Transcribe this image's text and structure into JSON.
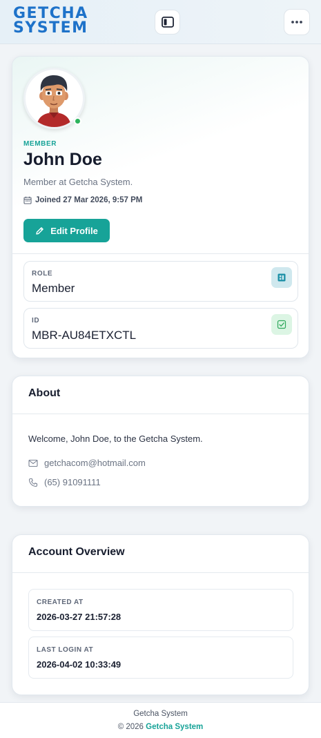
{
  "header": {
    "logo_line1": "GETCHA",
    "logo_line2": "SYSTEM",
    "sidebar_toggle_icon": "panel-left-icon",
    "more_icon": "more-horizontal-icon"
  },
  "profile": {
    "avatar_icon": "user-avatar",
    "online_status": "online",
    "badge": "MEMBER",
    "name": "John Doe",
    "subtitle": "Member at Getcha System.",
    "joined": "Joined 27 Mar 2026, 9:57 PM",
    "edit_button": "Edit Profile"
  },
  "role": {
    "label": "ROLE",
    "value": "Member"
  },
  "id_field": {
    "label": "ID",
    "value": "MBR-AU84ETXCTL"
  },
  "about": {
    "title": "About",
    "text": "Welcome, John Doe, to the Getcha System.",
    "email": "getchacom@hotmail.com",
    "phone": "(65) 91091111"
  },
  "overview": {
    "title": "Account Overview",
    "created_label": "CREATED AT",
    "created_value": "2026-03-27 21:57:28",
    "last_login_label": "LAST LOGIN AT",
    "last_login_value": "2026-04-02 10:33:49"
  },
  "footer": {
    "name": "Getcha System",
    "copyright_prefix": "© 2026",
    "brand": "Getcha System"
  },
  "colors": {
    "accent": "#17a398",
    "logo": "#1e72c9",
    "online": "#2cb35c"
  }
}
